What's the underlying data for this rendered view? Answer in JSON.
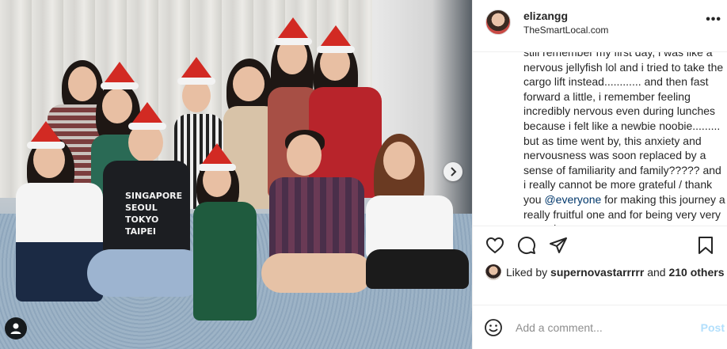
{
  "post": {
    "username": "elizangg",
    "location": "TheSmartLocal.com",
    "caption_before_mention": "still remember my first day, i was like a nervous jellyfish lol and i tried to take the cargo lift instead............ and then fast forward a little, i remember feeling incredibly nervous even during lunches because i felt like a newbie noobie......... but as time went by, this anxiety and nervousness was soon replaced by a sense of familiarity and family????? and i really cannot be more grateful / thank you ",
    "caption_mention": "@everyone",
    "caption_after_mention": " for making this journey a really fruitful one and for being very very very nice",
    "more_icon": "more-options-icon",
    "photo_description_icons": [
      "tag-people-icon",
      "next-photo-icon"
    ]
  },
  "actions": {
    "like_icon": "heart-icon",
    "comment_icon": "comment-icon",
    "share_icon": "paper-plane-icon",
    "save_icon": "bookmark-icon"
  },
  "likes": {
    "prefix": "Liked by ",
    "liker": "supernovastarrrrr",
    "middle": " and ",
    "others": "210 others"
  },
  "comment_box": {
    "placeholder": "Add a comment...",
    "post_label": "Post",
    "emoji_icon": "emoji-icon"
  },
  "photo_text": {
    "shirt_text": "SINGAPORE SEOUL TOKYO TAIPEI"
  },
  "colors": {
    "link": "#00376b",
    "post_disabled": "#b2dffc",
    "hat_red": "#d22a23"
  }
}
